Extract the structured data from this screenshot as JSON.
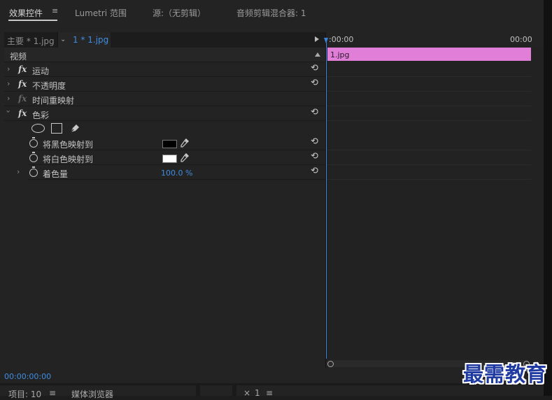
{
  "tabs": [
    {
      "label": "效果控件",
      "active": true
    },
    {
      "label": "Lumetri 范围",
      "active": false
    },
    {
      "label": "源:（无剪辑）",
      "active": false
    },
    {
      "label": "音频剪辑混合器: 1",
      "active": false
    }
  ],
  "breadcrumb": {
    "master": "主要 * 1.jpg",
    "clip": "1 * 1.jpg"
  },
  "section": "视频",
  "effects": [
    {
      "name": "运动",
      "fx_dim": false
    },
    {
      "name": "不透明度",
      "fx_dim": false
    },
    {
      "name": "时间重映射",
      "fx_dim": true
    },
    {
      "name": "色彩",
      "fx_dim": false
    }
  ],
  "params": [
    {
      "name": "将黑色映射到",
      "color": "#000000"
    },
    {
      "name": "将白色映射到",
      "color": "#ffffff"
    },
    {
      "name": "着色量",
      "value": "100.0 %"
    }
  ],
  "timeline": {
    "start": ":00:00",
    "end": "00:00",
    "clip_label": "1.jpg",
    "clip_color": "#e07ed8"
  },
  "timecode": "00:00:00:00",
  "bottom_tabs": [
    {
      "label": "项目: 10"
    },
    {
      "label": "媒体浏览器"
    },
    {
      "label": "1"
    }
  ],
  "watermark": "最需教育",
  "icons": {
    "menu": "≡",
    "reset": "⟲",
    "chevron_right": "›",
    "chevron_down": "⌄",
    "eyedropper": "eyedropper-icon",
    "pen": "pen-icon"
  },
  "accent_color": "#3f8de0"
}
